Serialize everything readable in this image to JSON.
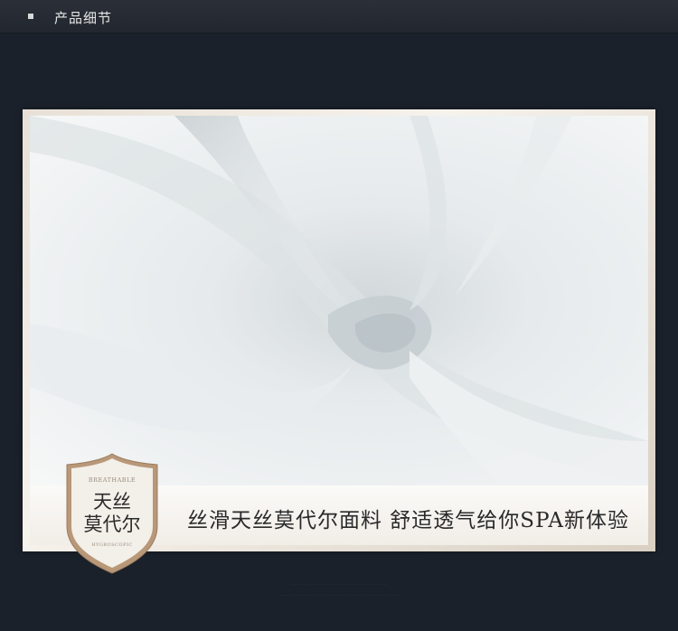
{
  "header": {
    "title": "产品细节"
  },
  "slogan": "丝滑天丝莫代尔面料 舒适透气给你SPA新体验",
  "badge": {
    "top_text": "BREATHABLE",
    "line1": "天丝",
    "line2": "莫代尔",
    "bottom_text": "HYGROSCOPIC"
  },
  "colors": {
    "background": "#1b212b",
    "fabric": "#e3e8ea",
    "badge_border": "#b89878"
  }
}
